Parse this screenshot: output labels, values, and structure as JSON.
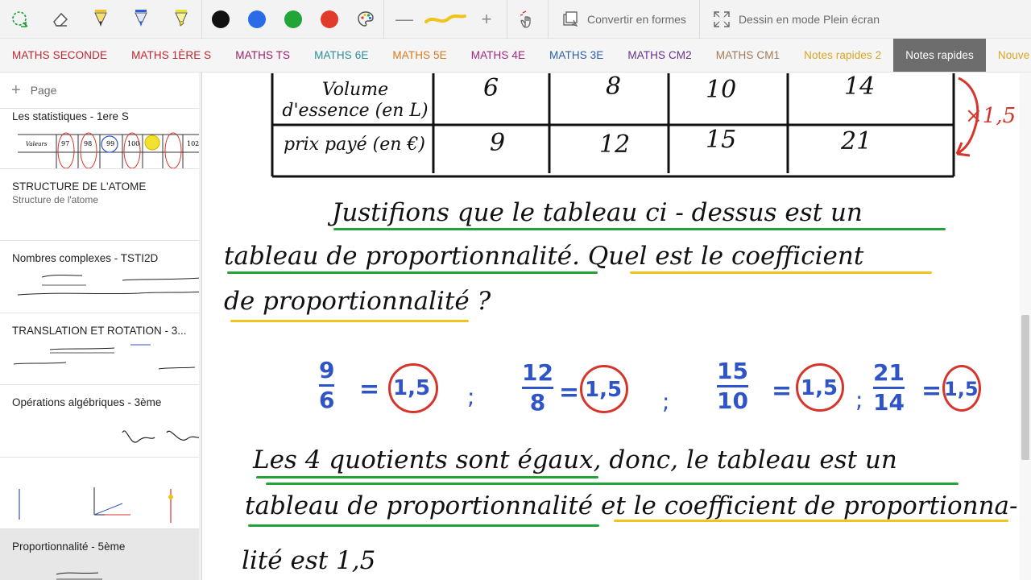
{
  "toolbar": {
    "convert_label": "Convertir en formes",
    "fullscreen_label": "Dessin en mode Plein écran",
    "colors": [
      "#111111",
      "#2b6bea",
      "#1fa637",
      "#e03b2b"
    ]
  },
  "tabs": [
    {
      "label": "MATHS SECONDE",
      "color": "#c0262f"
    },
    {
      "label": "MATHS 1ÈRE S",
      "color": "#c0262f"
    },
    {
      "label": "MATHS TS",
      "color": "#9c1f6b"
    },
    {
      "label": "MATHS 6E",
      "color": "#2a8f9c"
    },
    {
      "label": "MATHS 5E",
      "color": "#d77a20"
    },
    {
      "label": "MATHS 4E",
      "color": "#a3257f"
    },
    {
      "label": "MATHS 3E",
      "color": "#2a5faa"
    },
    {
      "label": "MATHS CM2",
      "color": "#6b2e8e"
    },
    {
      "label": "MATHS CM1",
      "color": "#a27a57"
    },
    {
      "label": "Notes rapides 2",
      "color": "#d9a520"
    },
    {
      "label": "Notes rapides",
      "color": "#ffffff",
      "active": true
    },
    {
      "label": "Nouve",
      "color": "#d9a520"
    }
  ],
  "sidebar": {
    "add_page_label": "Page",
    "pages": [
      {
        "title": "Les statistiques - 1ere S",
        "subtitle": ""
      },
      {
        "title": "STRUCTURE DE L'ATOME",
        "subtitle": "Structure de l'atome"
      },
      {
        "title": "Nombres complexes - TSTI2D",
        "subtitle": ""
      },
      {
        "title": "TRANSLATION ET ROTATION - 3...",
        "subtitle": ""
      },
      {
        "title": "Opérations algébriques - 3ème",
        "subtitle": ""
      },
      {
        "title": "",
        "subtitle": ""
      },
      {
        "title": "Proportionnalité - 5ème",
        "subtitle": ""
      }
    ]
  },
  "note": {
    "table": {
      "row1_header": "Volume d'essence (en L)",
      "row2_header": "prix payé (en €)",
      "row1": [
        "6",
        "8",
        "10",
        "14"
      ],
      "row2": [
        "9",
        "12",
        "15",
        "21"
      ],
      "factor": "×1,5"
    },
    "question_lines": [
      "Justifions que le tableau ci - dessus est un",
      "tableau de proportionnalité. Quel est le coefficient",
      "de proportionnalité ?"
    ],
    "fractions": [
      {
        "num": "9",
        "den": "6",
        "result": "1,5"
      },
      {
        "num": "12",
        "den": "8",
        "result": "1,5"
      },
      {
        "num": "15",
        "den": "10",
        "result": "1,5"
      },
      {
        "num": "21",
        "den": "14",
        "result": "1,5"
      }
    ],
    "separator": ";",
    "conclusion_lines": [
      "Les 4 quotients sont égaux, donc, le tableau est un",
      "tableau de proportionnalité et le coefficient de proportionna-",
      "lité est 1,5"
    ]
  }
}
